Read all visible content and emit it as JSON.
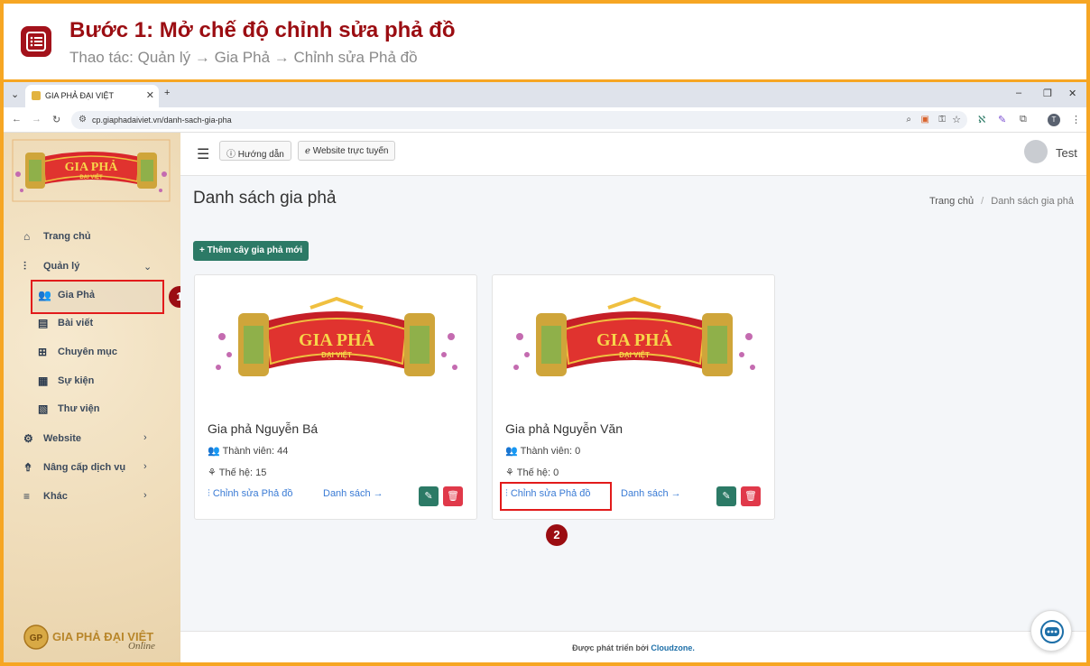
{
  "instruction": {
    "title": "Bước 1: Mở chế độ chỉnh sửa phả đồ",
    "subtitle": "Thao tác: Quản lý → Gia Phả → Chỉnh sửa Phả đồ"
  },
  "browser": {
    "tab_title": "GIA PHẢ ĐẠI VIỆT",
    "url": "cp.giaphadaiviet.vn/danh-sach-gia-pha",
    "profile_initial": "T"
  },
  "sidebar": {
    "items": [
      {
        "label": "Trang chủ",
        "icon": "home-icon"
      },
      {
        "label": "Quản lý",
        "icon": "sitemap-icon"
      },
      {
        "label": "Gia Phả",
        "icon": "users-icon"
      },
      {
        "label": "Bài viết",
        "icon": "newspaper-icon"
      },
      {
        "label": "Chuyên mục",
        "icon": "grid-icon"
      },
      {
        "label": "Sự kiện",
        "icon": "calendar-icon"
      },
      {
        "label": "Thư viện",
        "icon": "images-icon"
      },
      {
        "label": "Website",
        "icon": "gear-icon"
      },
      {
        "label": "Nâng cấp dịch vụ",
        "icon": "upgrade-icon"
      },
      {
        "label": "Khác",
        "icon": "bars-icon"
      }
    ],
    "logo_bottom_text": "GIA PHẢ ĐẠI VIỆT",
    "logo_bottom_script": "Online"
  },
  "topnav": {
    "guide_label": "Hướng dẫn",
    "website_label": "Website trực tuyến",
    "user_name": "Test"
  },
  "page": {
    "title": "Danh sách gia phả",
    "breadcrumb_home": "Trang chủ",
    "breadcrumb_sep": "/",
    "breadcrumb_current": "Danh sách gia phả",
    "add_button": "+ Thêm cây gia phả mới"
  },
  "logo": {
    "main": "GIA PHẢ",
    "sub": "ĐẠI VIỆT"
  },
  "cards": [
    {
      "title": "Gia phả Nguyễn Bá",
      "members": "Thành viên: 44",
      "generations": "Thế hệ: 15",
      "edit_link": "Chỉnh sửa Phả đồ",
      "list_link": "Danh sách →"
    },
    {
      "title": "Gia phả Nguyễn Văn",
      "members": "Thành viên: 0",
      "generations": "Thế hệ: 0",
      "edit_link": "Chỉnh sửa Phả đồ",
      "list_link": "Danh sách →"
    }
  ],
  "annotations": {
    "step1": "1",
    "step2": "2"
  },
  "footer": {
    "prefix": "Được phát triển bởi",
    "brand": "Cloudzone."
  },
  "colors": {
    "accent": "#f6a623",
    "brand_red": "#9b0d12",
    "teal": "#2c7a66",
    "danger": "#e0394a",
    "link": "#3a7bd5"
  }
}
